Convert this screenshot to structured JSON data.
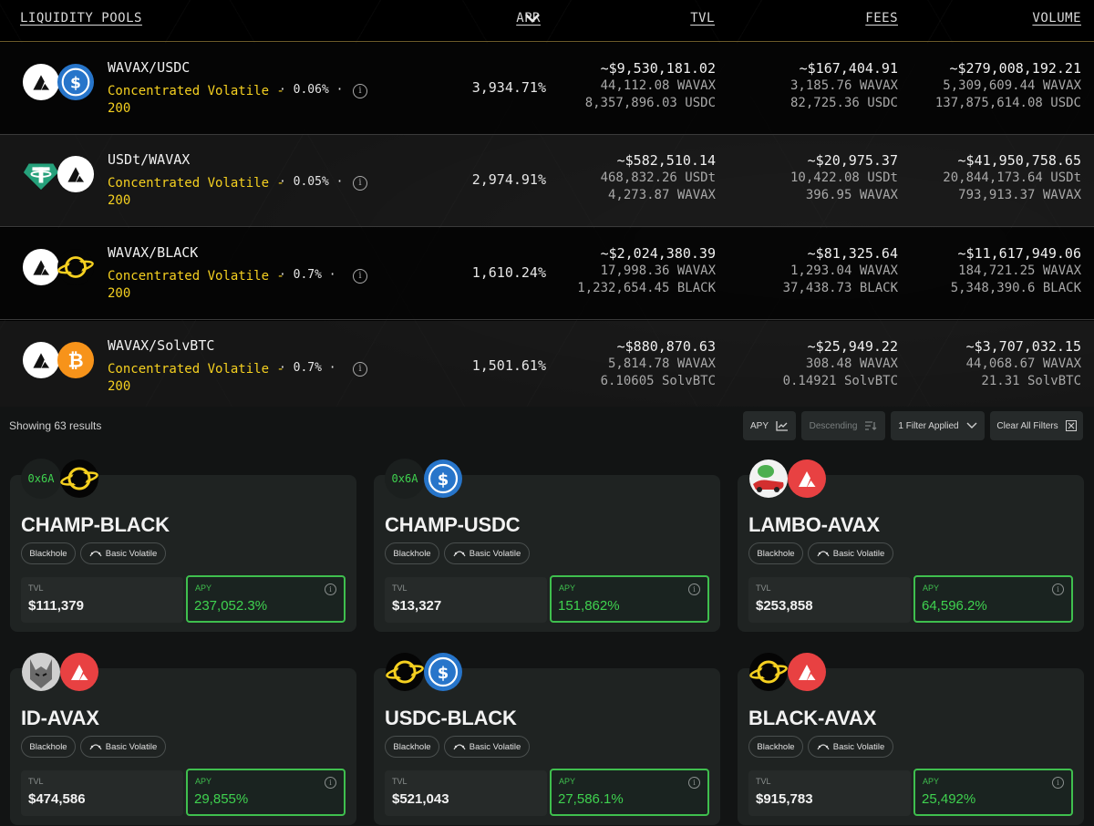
{
  "table": {
    "headers": {
      "pools": "LIQUIDITY POOLS",
      "apr": "APR",
      "tvl": "TVL",
      "fees": "FEES",
      "volume": "VOLUME"
    },
    "rows": [
      {
        "name": "WAVAX/USDC",
        "type": "Concentrated Volatile - 200",
        "fee": "· 0.06% ·",
        "apr": "3,934.71%",
        "tvl": {
          "main": "~$9,530,181.02",
          "a": "44,112.08 WAVAX",
          "b": "8,357,896.03 USDC"
        },
        "fees": {
          "main": "~$167,404.91",
          "a": "3,185.76 WAVAX",
          "b": "82,725.36 USDC"
        },
        "volume": {
          "main": "~$279,008,192.21",
          "a": "5,309,609.44 WAVAX",
          "b": "137,875,614.08 USDC"
        },
        "icons": [
          "avax-icon",
          "usdc-icon"
        ]
      },
      {
        "name": "USDt/WAVAX",
        "type": "Concentrated Volatile - 200",
        "fee": "· 0.05% ·",
        "apr": "2,974.91%",
        "tvl": {
          "main": "~$582,510.14",
          "a": "468,832.26 USDt",
          "b": "4,273.87 WAVAX"
        },
        "fees": {
          "main": "~$20,975.37",
          "a": "10,422.08 USDt",
          "b": "396.95 WAVAX"
        },
        "volume": {
          "main": "~$41,950,758.65",
          "a": "20,844,173.64 USDt",
          "b": "793,913.37 WAVAX"
        },
        "icons": [
          "usdt-icon",
          "avax-icon"
        ]
      },
      {
        "name": "WAVAX/BLACK",
        "type": "Concentrated Volatile - 200",
        "fee": "· 0.7% ·",
        "apr": "1,610.24%",
        "tvl": {
          "main": "~$2,024,380.39",
          "a": "17,998.36 WAVAX",
          "b": "1,232,654.45 BLACK"
        },
        "fees": {
          "main": "~$81,325.64",
          "a": "1,293.04 WAVAX",
          "b": "37,438.73 BLACK"
        },
        "volume": {
          "main": "~$11,617,949.06",
          "a": "184,721.25 WAVAX",
          "b": "5,348,390.6 BLACK"
        },
        "icons": [
          "avax-icon",
          "blackhole-icon"
        ]
      },
      {
        "name": "WAVAX/SolvBTC",
        "type": "Concentrated Volatile - 200",
        "fee": "· 0.7% ·",
        "apr": "1,501.61%",
        "tvl": {
          "main": "~$880,870.63",
          "a": "5,814.78 WAVAX",
          "b": "6.10605 SolvBTC"
        },
        "fees": {
          "main": "~$25,949.22",
          "a": "308.48 WAVAX",
          "b": "0.14921 SolvBTC"
        },
        "volume": {
          "main": "~$3,707,032.15",
          "a": "44,068.67 WAVAX",
          "b": "21.31 SolvBTC"
        },
        "icons": [
          "avax-icon",
          "bitcoin-icon"
        ]
      }
    ]
  },
  "toolbar": {
    "results": "Showing 63 results",
    "sort_key": "APY",
    "sort_dir": "Descending",
    "filters": "1 Filter Applied",
    "clear": "Clear All Filters"
  },
  "cards": [
    {
      "name": "CHAMP-BLACK",
      "tag1": "Blackhole",
      "tag2": "Basic Volatile",
      "tvl_label": "TVL",
      "tvl": "$111,379",
      "apy_label": "APY",
      "apy": "237,052.3%",
      "token_a_text": "0x6A",
      "icons": [
        "champ-icon",
        "blackhole-icon"
      ]
    },
    {
      "name": "CHAMP-USDC",
      "tag1": "Blackhole",
      "tag2": "Basic Volatile",
      "tvl_label": "TVL",
      "tvl": "$13,327",
      "apy_label": "APY",
      "apy": "151,862%",
      "token_a_text": "0x6A",
      "icons": [
        "champ-icon",
        "usdc-icon"
      ]
    },
    {
      "name": "LAMBO-AVAX",
      "tag1": "Blackhole",
      "tag2": "Basic Volatile",
      "tvl_label": "TVL",
      "tvl": "$253,858",
      "apy_label": "APY",
      "apy": "64,596.2%",
      "token_a_text": "",
      "icons": [
        "lambo-icon",
        "avax-icon"
      ]
    },
    {
      "name": "ID-AVAX",
      "tag1": "Blackhole",
      "tag2": "Basic Volatile",
      "tvl_label": "TVL",
      "tvl": "$474,586",
      "apy_label": "APY",
      "apy": "29,855%",
      "token_a_text": "",
      "icons": [
        "wolf-icon",
        "avax-icon"
      ]
    },
    {
      "name": "USDC-BLACK",
      "tag1": "Blackhole",
      "tag2": "Basic Volatile",
      "tvl_label": "TVL",
      "tvl": "$521,043",
      "apy_label": "APY",
      "apy": "27,586.1%",
      "token_a_text": "",
      "icons": [
        "blackhole-icon",
        "usdc-icon"
      ]
    },
    {
      "name": "BLACK-AVAX",
      "tag1": "Blackhole",
      "tag2": "Basic Volatile",
      "tvl_label": "TVL",
      "tvl": "$915,783",
      "apy_label": "APY",
      "apy": "25,492%",
      "token_a_text": "",
      "icons": [
        "blackhole-icon",
        "avax-icon"
      ]
    }
  ],
  "colors": {
    "accent_yellow": "#f5d020",
    "apy_green": "#3fd24f",
    "avax_red": "#e84142",
    "usdc_blue": "#2775ca",
    "usdt_teal": "#26a17b",
    "btc_orange": "#f7931a"
  }
}
